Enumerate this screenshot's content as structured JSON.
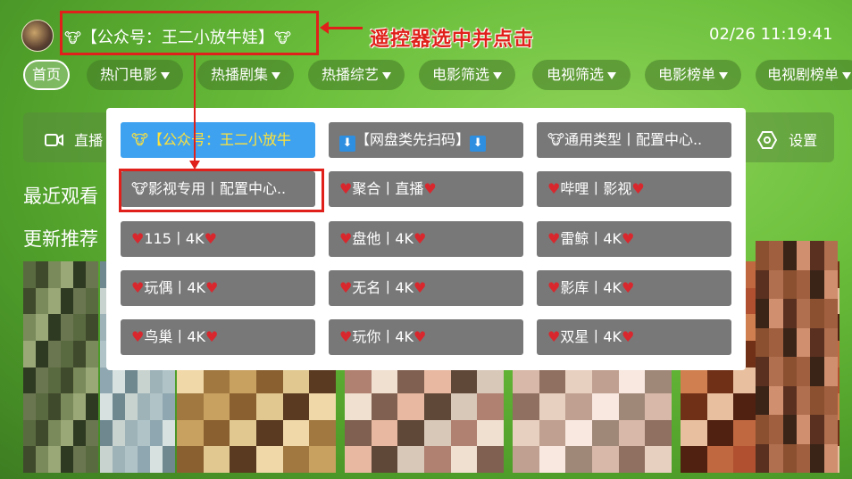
{
  "header": {
    "source_title": "【公众号：王二小放牛娃】",
    "cow_glyph": "🐮",
    "annotation": "遥控器选中并点击",
    "datetime": "02/26 11:19:41"
  },
  "tabs": [
    {
      "label": "首页",
      "filter": false,
      "active": true
    },
    {
      "label": "热门电影",
      "filter": true
    },
    {
      "label": "热播剧集",
      "filter": true
    },
    {
      "label": "热播综艺",
      "filter": true
    },
    {
      "label": "电影筛选",
      "filter": true
    },
    {
      "label": "电视筛选",
      "filter": true
    },
    {
      "label": "电影榜单",
      "filter": true
    },
    {
      "label": "电视剧榜单",
      "filter": true
    }
  ],
  "background": {
    "live_label": "直播",
    "settings_label": "设置",
    "recent_label": "最近观看",
    "recommend_label": "更新推荐"
  },
  "popup": {
    "items": [
      {
        "prefix": "🐮",
        "text": "【公众号：王二小放牛",
        "suffix": "",
        "selected": true
      },
      {
        "prefix": "⬇",
        "text": "【网盘类先扫码】",
        "suffix": "⬇",
        "selected": false
      },
      {
        "prefix": "🐮",
        "text": "通用类型丨配置中心..",
        "suffix": "",
        "selected": false
      },
      {
        "prefix": "🐮",
        "text": "影视专用丨配置中心..",
        "suffix": "",
        "selected": false
      },
      {
        "prefix": "♥",
        "text": "聚合丨直播",
        "suffix": "♥",
        "selected": false
      },
      {
        "prefix": "♥",
        "text": "哔哩丨影视",
        "suffix": "♥",
        "selected": false
      },
      {
        "prefix": "♥",
        "text": "115丨4K",
        "suffix": "♥",
        "selected": false
      },
      {
        "prefix": "♥",
        "text": "盘他丨4K",
        "suffix": "♥",
        "selected": false
      },
      {
        "prefix": "♥",
        "text": "雷鲸丨4K",
        "suffix": "♥",
        "selected": false
      },
      {
        "prefix": "♥",
        "text": "玩偶丨4K",
        "suffix": "♥",
        "selected": false
      },
      {
        "prefix": "♥",
        "text": "无名丨4K",
        "suffix": "♥",
        "selected": false
      },
      {
        "prefix": "♥",
        "text": "影库丨4K",
        "suffix": "♥",
        "selected": false
      },
      {
        "prefix": "♥",
        "text": "鸟巢丨4K",
        "suffix": "♥",
        "selected": false
      },
      {
        "prefix": "♥",
        "text": "玩你丨4K",
        "suffix": "♥",
        "selected": false
      },
      {
        "prefix": "♥",
        "text": "双星丨4K",
        "suffix": "♥",
        "selected": false
      }
    ]
  },
  "colors": {
    "annotation_red": "#e0201a",
    "selected_bg": "#3ea2f0",
    "selected_text": "#ffe23a",
    "item_bg": "#787878",
    "heart": "#d8282e"
  }
}
